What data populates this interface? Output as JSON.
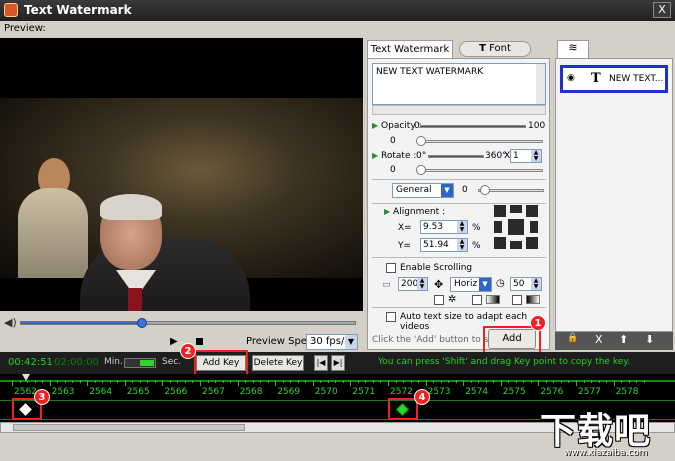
{
  "window": {
    "title": "Text Watermark",
    "close_glyph": "X"
  },
  "preview": {
    "label": "Preview:"
  },
  "playback": {
    "seek_progress": 0.36,
    "speed_label": "Preview Speed:",
    "speed_value": "30 fps/s"
  },
  "panel": {
    "tabs": {
      "text": "Text Watermark",
      "font": "Font",
      "font_icon": "T"
    },
    "text_content": "NEW TEXT WATERMARK",
    "opacity": {
      "label": "Opacity",
      "min": "0",
      "max": "100",
      "value": "0"
    },
    "rotate": {
      "label": "Rotate",
      "min": "0°",
      "max": "360°",
      "value": "0",
      "multiplier": "1",
      "x_sign": "X"
    },
    "style": {
      "selected": "General",
      "value": "0"
    },
    "alignment": {
      "label": "Alignment :",
      "x_label": "X=",
      "x_value": "9.53",
      "y_label": "Y=",
      "y_value": "51.94",
      "unit": "%"
    },
    "scrolling": {
      "label": "Enable Scrolling",
      "speed": "200",
      "direction": "Horiz",
      "duration": "50"
    },
    "auto_text": {
      "label": "Auto text size to adapt each videos"
    },
    "hint": "Click the 'Add' button to start ->",
    "add_button": "Add"
  },
  "layers": {
    "item_label": "NEW TEXT...",
    "item_icon": "T",
    "toolbar": {
      "lock": "🔒",
      "delete": "X",
      "up": "⬆",
      "down": "⬇"
    }
  },
  "timeline": {
    "current_time": "00:42:51",
    "total_time": "02:00:00",
    "min_label": "Min.",
    "sec_label": "Sec.",
    "add_key": "Add Key",
    "delete_key": "Delete Key",
    "hint": "You can press 'Shift' and drag Key point to copy the key.",
    "ticks": [
      "2562",
      "2563",
      "2564",
      "2565",
      "2566",
      "2567",
      "2568",
      "2569",
      "2570",
      "2571",
      "2572",
      "2573",
      "2574",
      "2575",
      "2576",
      "2577",
      "2578"
    ]
  },
  "annotations": {
    "n1": "1",
    "n2": "2",
    "n3": "3",
    "n4": "4"
  },
  "watermark": {
    "big": "下载吧",
    "small": "www.xiazaiba.com"
  },
  "colors": {
    "accent_red": "#e22222",
    "timeline_green": "#2fd42f",
    "layer_border": "#1f2fcf"
  }
}
